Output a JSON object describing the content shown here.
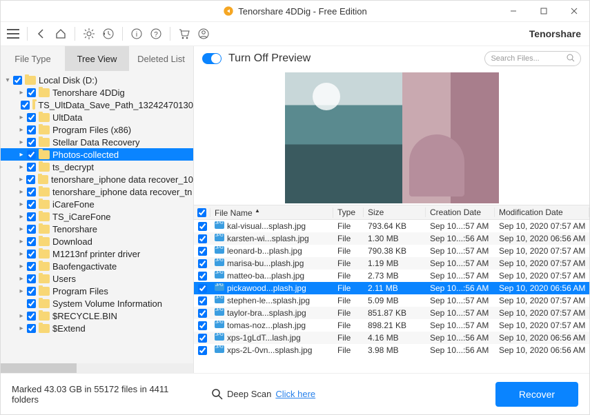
{
  "title": "Tenorshare 4DDig - Free Edition",
  "brand": "Tenorshare",
  "tabs": {
    "file_type": "File Type",
    "tree_view": "Tree View",
    "deleted_list": "Deleted List"
  },
  "toggle_label": "Turn Off Preview",
  "search_placeholder": "Search Files...",
  "tree": {
    "root": "Local Disk (D:)",
    "children": [
      "Tenorshare 4DDig",
      "TS_UltData_Save_Path_13242470130",
      "UltData",
      "Program Files (x86)",
      "Stellar Data Recovery",
      "Photos-collected",
      "ts_decrypt",
      "tenorshare_iphone data recover_10",
      "tenorshare_iphone data recover_tn",
      "iCareFone",
      "TS_iCareFone",
      "Tenorshare",
      "Download",
      "M1213nf printer driver",
      "Baofengactivate",
      "Users",
      "Program Files",
      "System Volume Information",
      "$RECYCLE.BIN",
      "$Extend"
    ],
    "selected_index": 5,
    "no_expand": [
      1,
      17
    ]
  },
  "columns": {
    "name": "File Name",
    "type": "Type",
    "size": "Size",
    "creation": "Creation Date",
    "modification": "Modification Date"
  },
  "files": [
    {
      "name": "kal-visual...splash.jpg",
      "type": "File",
      "size": "793.64 KB",
      "cre": "Sep 10...:57 AM",
      "mod": "Sep 10, 2020 07:57 AM"
    },
    {
      "name": "karsten-wi...splash.jpg",
      "type": "File",
      "size": "1.30 MB",
      "cre": "Sep 10...:56 AM",
      "mod": "Sep 10, 2020 06:56 AM"
    },
    {
      "name": "leonard-b...plash.jpg",
      "type": "File",
      "size": "790.38 KB",
      "cre": "Sep 10...:57 AM",
      "mod": "Sep 10, 2020 07:57 AM"
    },
    {
      "name": "marisa-bu...plash.jpg",
      "type": "File",
      "size": "1.19 MB",
      "cre": "Sep 10...:57 AM",
      "mod": "Sep 10, 2020 07:57 AM"
    },
    {
      "name": "matteo-ba...plash.jpg",
      "type": "File",
      "size": "2.73 MB",
      "cre": "Sep 10...:57 AM",
      "mod": "Sep 10, 2020 07:57 AM"
    },
    {
      "name": "pickawood...plash.jpg",
      "type": "File",
      "size": "2.11 MB",
      "cre": "Sep 10...:56 AM",
      "mod": "Sep 10, 2020 06:56 AM"
    },
    {
      "name": "stephen-le...splash.jpg",
      "type": "File",
      "size": "5.09 MB",
      "cre": "Sep 10...:57 AM",
      "mod": "Sep 10, 2020 07:57 AM"
    },
    {
      "name": "taylor-bra...splash.jpg",
      "type": "File",
      "size": "851.87 KB",
      "cre": "Sep 10...:57 AM",
      "mod": "Sep 10, 2020 07:57 AM"
    },
    {
      "name": "tomas-noz...plash.jpg",
      "type": "File",
      "size": "898.21 KB",
      "cre": "Sep 10...:57 AM",
      "mod": "Sep 10, 2020 07:57 AM"
    },
    {
      "name": "xps-1gLdT...lash.jpg",
      "type": "File",
      "size": "4.16 MB",
      "cre": "Sep 10...:56 AM",
      "mod": "Sep 10, 2020 06:56 AM"
    },
    {
      "name": "xps-2L-0vn...splash.jpg",
      "type": "File",
      "size": "3.98 MB",
      "cre": "Sep 10...:56 AM",
      "mod": "Sep 10, 2020 06:56 AM"
    }
  ],
  "file_selected_index": 5,
  "footer": {
    "status": "Marked 43.03 GB in 55172 files in 4411 folders",
    "deep_label": "Deep Scan",
    "deep_link": "Click here",
    "recover": "Recover"
  }
}
